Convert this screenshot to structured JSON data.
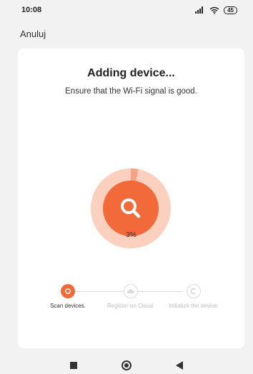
{
  "status_bar": {
    "time": "10:08",
    "battery": "45",
    "icons": [
      "signal-icon",
      "wifi-icon",
      "battery-icon"
    ]
  },
  "header": {
    "cancel_label": "Anuluj"
  },
  "card": {
    "title": "Adding device...",
    "subtitle": "Ensure that the Wi-Fi signal is good.",
    "progress_percent_label": "3%",
    "progress": 0.03,
    "scan_icon": "search-icon"
  },
  "steps": [
    {
      "label": "Scan devices.",
      "state": "active",
      "icon": "scan-icon"
    },
    {
      "label": "Register on Cloud.",
      "state": "inactive",
      "icon": "cloud-icon"
    },
    {
      "label": "Initialize the device.",
      "state": "inactive",
      "icon": "initialize-icon"
    }
  ],
  "colors": {
    "accent": "#f26a3a",
    "accent_light": "#fbd0bf",
    "inactive": "#dcdcdc"
  },
  "nav_bar": {
    "icons": [
      "recent-apps-icon",
      "home-icon",
      "back-icon"
    ]
  }
}
